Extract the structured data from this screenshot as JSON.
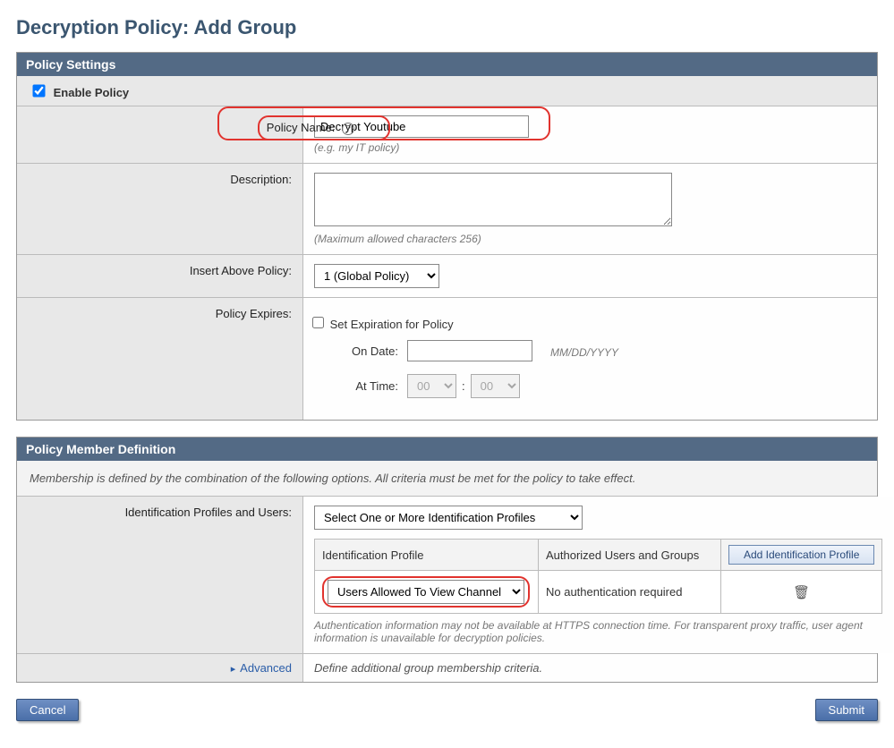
{
  "page_title": "Decryption Policy: Add Group",
  "panels": {
    "settings": {
      "header": "Policy Settings",
      "enable_label": "Enable Policy",
      "enable_checked": true,
      "policy_name_label": "Policy Name:",
      "policy_name_value": "Decrypt Youtube",
      "policy_name_hint": "(e.g. my IT policy)",
      "description_label": "Description:",
      "description_value": "",
      "description_hint": "(Maximum allowed characters 256)",
      "insert_above_label": "Insert Above Policy:",
      "insert_above_selected": "1 (Global Policy)",
      "policy_expires_label": "Policy Expires:",
      "set_expiration_label": "Set Expiration for Policy",
      "on_date_label": "On Date:",
      "on_date_placeholder": "MM/DD/YYYY",
      "at_time_label": "At Time:",
      "time_hour": "00",
      "time_min": "00"
    },
    "member": {
      "header": "Policy Member Definition",
      "note": "Membership is defined by the combination of the following options. All criteria must be met for the policy to take effect.",
      "id_profiles_label": "Identification Profiles and Users:",
      "id_profiles_selected": "Select One or More Identification Profiles",
      "table": {
        "col_profile": "Identification Profile",
        "col_users": "Authorized Users and Groups",
        "add_button": "Add Identification Profile",
        "row_profile_selected": "Users Allowed To View Channel",
        "row_users_text": "No authentication required"
      },
      "auth_note": "Authentication information may not be available at HTTPS connection time. For transparent proxy traffic, user agent information is unavailable for decryption policies.",
      "advanced_label": "Advanced",
      "advanced_text": "Define additional group membership criteria."
    }
  },
  "buttons": {
    "cancel": "Cancel",
    "submit": "Submit"
  }
}
